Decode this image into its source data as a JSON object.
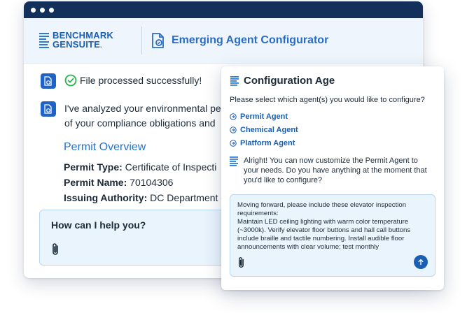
{
  "brand": {
    "line1": "BENCHMARK",
    "line2": "GENSUITE",
    "mark": "."
  },
  "app": {
    "title": "Emerging Agent Configurator"
  },
  "chat": {
    "status_message": "File processed successfully!",
    "analysis_line1": "I've analyzed your environmental pe",
    "analysis_line2": "of your compliance obligations and"
  },
  "permit": {
    "heading": "Permit Overview",
    "rows": [
      {
        "label": "Permit Type:",
        "value": "Certificate of Inspecti"
      },
      {
        "label": "Permit Name:",
        "value": "70104306"
      },
      {
        "label": "Issuing Authority:",
        "value": "DC Department c"
      }
    ]
  },
  "help": {
    "label": "How can I help you?"
  },
  "panel": {
    "title": "Configuration Age",
    "question": "Please select which agent(s) you would like to configure?",
    "options": [
      {
        "label": "Permit Agent"
      },
      {
        "label": "Chemical Agent"
      },
      {
        "label": "Platform Agent"
      }
    ],
    "reply": "Alright! You can now customize the Permit Agent to your needs. Do you have anything at the moment that you'd like to configure?",
    "composer_text": "Moving forward, please include these elevator inspection requirements:\nMaintain LED ceiling lighting with warm color temperature (~3000k). Verify elevator floor buttons and hall call buttons include braille and tactile numbering. Install audible floor announcements with clear volume; test monthly"
  },
  "colors": {
    "navy": "#13305a",
    "accent": "#1a5fb4",
    "success": "#2bb24c",
    "panel_bg": "#e9f4fd"
  },
  "icons": {
    "status": "check-circle-icon",
    "bot": "document-gear-icon",
    "attach": "paperclip-icon",
    "send": "arrow-up-icon",
    "option": "arrow-right-circle-icon",
    "list": "list-lines-icon"
  }
}
